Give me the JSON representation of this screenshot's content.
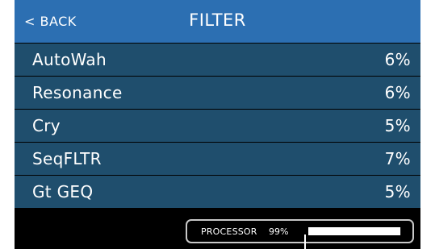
{
  "header": {
    "back_label": "< BACK",
    "title": "FILTER"
  },
  "effects": [
    {
      "name": "AutoWah",
      "value": "6%"
    },
    {
      "name": "Resonance",
      "value": "6%"
    },
    {
      "name": "Cry",
      "value": "5%"
    },
    {
      "name": "SeqFLTR",
      "value": "7%"
    },
    {
      "name": "Gt GEQ",
      "value": "5%"
    }
  ],
  "processor": {
    "label": "PROCESSOR",
    "value": "99%",
    "level_percent": 99
  },
  "colors": {
    "header_bg": "#2c6fb2",
    "row_bg": "#1f4e6d",
    "screen_bg": "#000000"
  }
}
